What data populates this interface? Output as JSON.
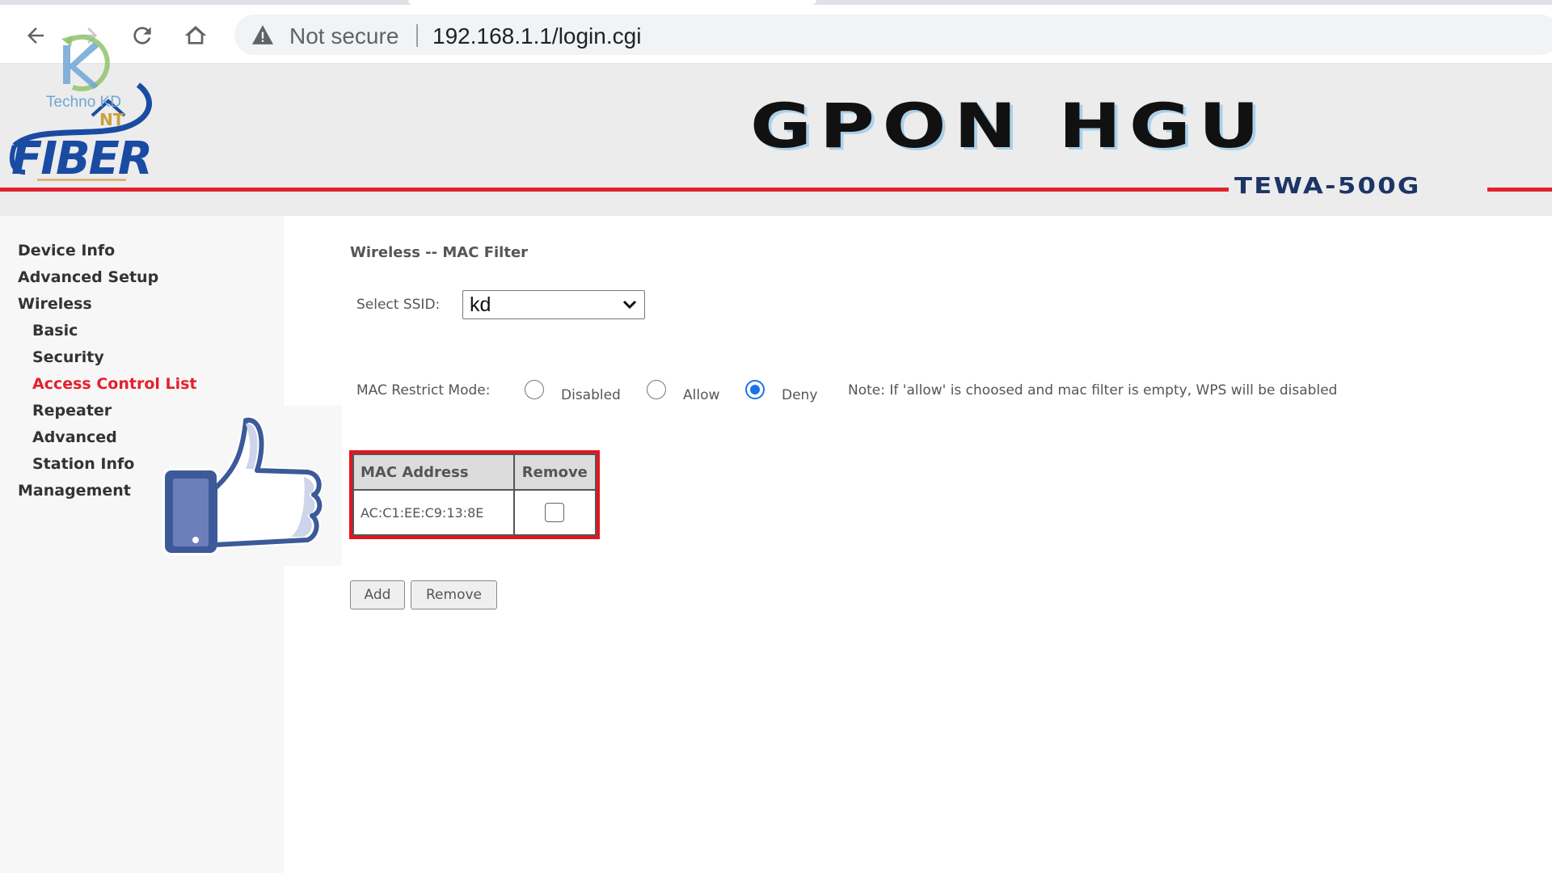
{
  "browser": {
    "security_label": "Not secure",
    "url": "192.168.1.1/login.cgi"
  },
  "watermark": {
    "text": "Techno KD"
  },
  "header": {
    "logo_text": "FIBER",
    "logo_badge": "NT",
    "title": "GPON HGU",
    "model": "TEWA-500G",
    "accent_color": "#e0232f"
  },
  "sidebar": {
    "items": [
      {
        "label": "Device Info",
        "level": 0,
        "active": false
      },
      {
        "label": "Advanced Setup",
        "level": 0,
        "active": false
      },
      {
        "label": "Wireless",
        "level": 0,
        "active": false
      },
      {
        "label": "Basic",
        "level": 1,
        "active": false
      },
      {
        "label": "Security",
        "level": 1,
        "active": false
      },
      {
        "label": "Access Control List",
        "level": 1,
        "active": true
      },
      {
        "label": "Repeater",
        "level": 1,
        "active": false
      },
      {
        "label": "Advanced",
        "level": 1,
        "active": false
      },
      {
        "label": "Station Info",
        "level": 1,
        "active": false
      },
      {
        "label": "Management",
        "level": 0,
        "active": false
      }
    ],
    "active_color": "#e5202e"
  },
  "main": {
    "title": "Wireless -- MAC Filter",
    "ssid_label": "Select SSID:",
    "ssid_value": "kd",
    "restrict_label": "MAC Restrict Mode:",
    "modes": [
      {
        "label": "Disabled",
        "checked": false
      },
      {
        "label": "Allow",
        "checked": false
      },
      {
        "label": "Deny",
        "checked": true
      }
    ],
    "note": "Note: If 'allow' is choosed and mac filter is empty, WPS will be disabled",
    "table": {
      "headers": [
        "MAC Address",
        "Remove"
      ],
      "rows": [
        {
          "mac": "AC:C1:EE:C9:13:8E",
          "remove_checked": false
        }
      ]
    },
    "buttons": {
      "add": "Add",
      "remove": "Remove"
    }
  }
}
